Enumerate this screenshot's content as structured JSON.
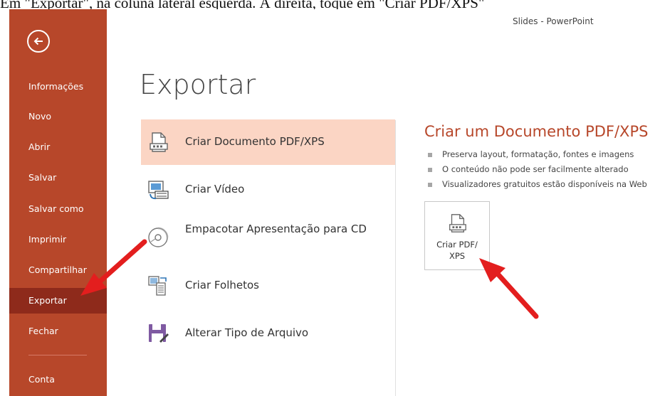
{
  "caption": "Em \"Exportar\", na coluna lateral esquerda. À direita, toque em \"Criar PDF/XPS\"",
  "window_title": "Slides  -  PowerPoint",
  "sidebar": {
    "back_icon": "back-arrow-icon",
    "items": [
      {
        "label": "Informações"
      },
      {
        "label": "Novo"
      },
      {
        "label": "Abrir"
      },
      {
        "label": "Salvar"
      },
      {
        "label": "Salvar como"
      },
      {
        "label": "Imprimir"
      },
      {
        "label": "Compartilhar"
      },
      {
        "label": "Exportar",
        "active": true
      },
      {
        "label": "Fechar"
      },
      {
        "label": "Conta"
      }
    ],
    "color": "#b7472a",
    "active_color": "#8e2a1b"
  },
  "main": {
    "title": "Exportar",
    "options": [
      {
        "label": "Criar Documento PDF/XPS",
        "icon": "pdf-document-icon",
        "selected": true
      },
      {
        "label": "Criar Vídeo",
        "icon": "video-icon"
      },
      {
        "label": "Empacotar Apresentação para CD",
        "icon": "cd-icon"
      },
      {
        "label": "Criar Folhetos",
        "icon": "handouts-icon"
      },
      {
        "label": "Alterar Tipo de Arquivo",
        "icon": "save-as-icon"
      }
    ],
    "selected_color": "#fbd5c4"
  },
  "detail": {
    "title": "Criar um Documento PDF/XPS",
    "bullets": [
      "Preserva layout, formatação, fontes e imagens",
      "O conteúdo não pode ser facilmente alterado",
      "Visualizadores gratuitos estão disponíveis na Web"
    ],
    "button_label_line1": "Criar PDF/",
    "button_label_line2": "XPS",
    "title_color": "#b7472a"
  },
  "annotations": {
    "arrow_color": "#e31e1e"
  }
}
